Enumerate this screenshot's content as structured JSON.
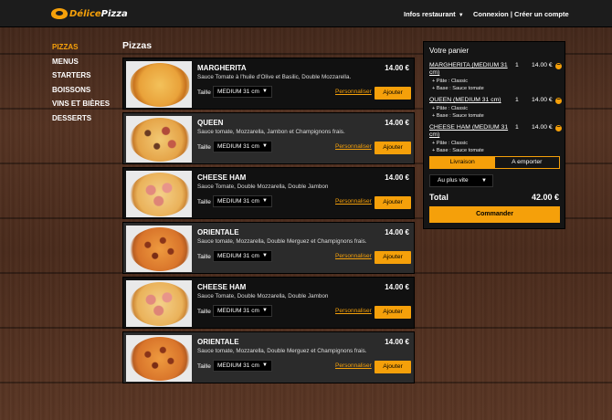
{
  "header": {
    "logo_text_a": "Délice",
    "logo_text_b": "Pizza",
    "infos": "Infos restaurant",
    "login": "Connexion",
    "separator": "|",
    "signup": "Créer un compte"
  },
  "sidebar": {
    "items": [
      {
        "label": "PIZZAS",
        "active": true
      },
      {
        "label": "MENUS"
      },
      {
        "label": "STARTERS"
      },
      {
        "label": "BOISSONS"
      },
      {
        "label": "VINS ET BIÈRES"
      },
      {
        "label": "DESSERTS"
      }
    ]
  },
  "main": {
    "title": "Pizzas",
    "size_label": "Taille",
    "customize_label": "Personnaliser",
    "add_label": "Ajouter",
    "products": [
      {
        "name": "MARGHERITA",
        "price": "14.00 €",
        "desc": "Sauce Tomate à l'huile d'Olive et Basilic, Double Mozzarella.",
        "size": "MEDIUM 31 cm",
        "image": "pizza-margherita"
      },
      {
        "name": "QUEEN",
        "price": "14.00 €",
        "desc": "Sauce tomate, Mozzarella, Jambon et Champignons frais.",
        "size": "MEDIUM 31 cm",
        "image": "pizza-queen"
      },
      {
        "name": "CHEESE HAM",
        "price": "14.00 €",
        "desc": "Sauce Tomate, Double Mozzarella, Double Jambon",
        "size": "MEDIUM 31 cm",
        "image": "pizza-cheese-ham"
      },
      {
        "name": "ORIENTALE",
        "price": "14.00 €",
        "desc": "Sauce tomate, Mozzarella, Double Merguez et Champignons frais.",
        "size": "MEDIUM 31 cm",
        "image": "pizza-orientale"
      },
      {
        "name": "CHEESE HAM",
        "price": "14.00 €",
        "desc": "Sauce Tomate, Double Mozzarella, Double Jambon",
        "size": "MEDIUM 31 cm",
        "image": "pizza-cheese-ham"
      },
      {
        "name": "ORIENTALE",
        "price": "14.00 €",
        "desc": "Sauce tomate, Mozzarella, Double Merguez et Champignons frais.",
        "size": "MEDIUM 31 cm",
        "image": "pizza-orientale"
      }
    ]
  },
  "cart": {
    "title": "Votre panier",
    "items": [
      {
        "name": "MARGHERITA (MEDIUM 31 cm)",
        "qty": "1",
        "price": "14.00 €",
        "opts": [
          "+ Pâte : Classic",
          "+ Base : Sauce tomate"
        ]
      },
      {
        "name": "QUEEN (MEDIUM 31 cm)",
        "qty": "1",
        "price": "14.00 €",
        "opts": [
          "+ Pâte : Classic",
          "+ Base : Sauce tomate"
        ]
      },
      {
        "name": "CHEESE HAM (MEDIUM 31 cm)",
        "qty": "1",
        "price": "14.00 €",
        "opts": [
          "+ Pâte : Classic",
          "+ Base : Sauce tomate"
        ]
      }
    ],
    "delivery": "Livraison",
    "takeaway": "A emporter",
    "when": "Au plus vite",
    "total_label": "Total",
    "total_value": "42.00 €",
    "order": "Commander"
  },
  "colors": {
    "accent": "#f5a00a",
    "dark": "#111111"
  }
}
